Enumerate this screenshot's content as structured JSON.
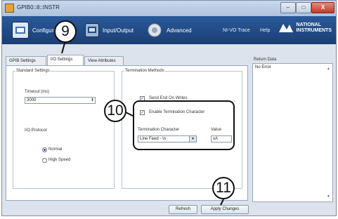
{
  "window": {
    "title": "GPIB0::8::INSTR",
    "close_label": "X"
  },
  "toolbar": {
    "config_label": "Configuration",
    "io_label": "Input/Output",
    "advanced_label": "Advanced",
    "nivo_trace_label": "NI-VO Trace",
    "help_label": "Help",
    "logo_line1": "NATIONAL",
    "logo_line2": "INSTRUMENTS"
  },
  "tabs": [
    "GPIB Settings",
    "I/O Settings",
    "View Attributes"
  ],
  "standard_settings": {
    "title": "Standard Settings",
    "timeout_label": "Timeout (ms)",
    "timeout_value": "3000",
    "io_protocol_label": "I/O Protocol",
    "protocol_options": [
      "Normal",
      "High Speed"
    ]
  },
  "termination": {
    "title": "Termination Methods",
    "send_end_label": "Send End On Writes",
    "enable_term_label": "Enable Termination Character",
    "term_char_label": "Termination Character",
    "term_char_value": "Line Feed - \\n",
    "value_label": "Value",
    "value_value": "xA"
  },
  "return_data": {
    "label": "Return Data",
    "value": "No Error"
  },
  "buttons": {
    "refresh": "Refresh",
    "apply": "Apply Changes"
  },
  "callouts": {
    "c9": "9",
    "c10": "10",
    "c11": "11"
  }
}
